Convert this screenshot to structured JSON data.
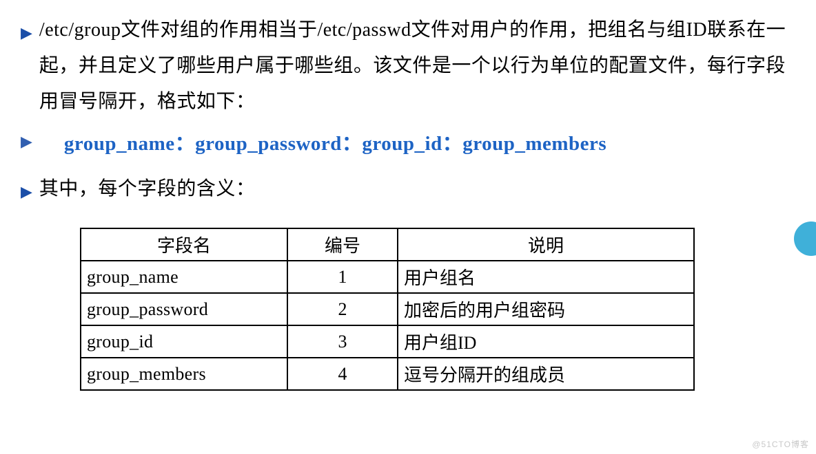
{
  "paragraph1": "/etc/group文件对组的作用相当于/etc/passwd文件对用户的作用，把组名与组ID联系在一起，并且定义了哪些用户属于哪些组。该文件是一个以行为单位的配置文件，每行字段用冒号隔开，格式如下：",
  "format_line": "group_name：group_password：group_id：group_members",
  "paragraph2": "其中，每个字段的含义：",
  "table": {
    "headers": {
      "field": "字段名",
      "number": "编号",
      "desc": "说明"
    },
    "rows": [
      {
        "field": "group_name",
        "number": "1",
        "desc": "用户组名"
      },
      {
        "field": "group_password",
        "number": "2",
        "desc": "加密后的用户组密码"
      },
      {
        "field": "group_id",
        "number": "3",
        "desc": "用户组ID"
      },
      {
        "field": "group_members",
        "number": "4",
        "desc": "逗号分隔开的组成员"
      }
    ]
  },
  "watermark": "@51CTO博客"
}
